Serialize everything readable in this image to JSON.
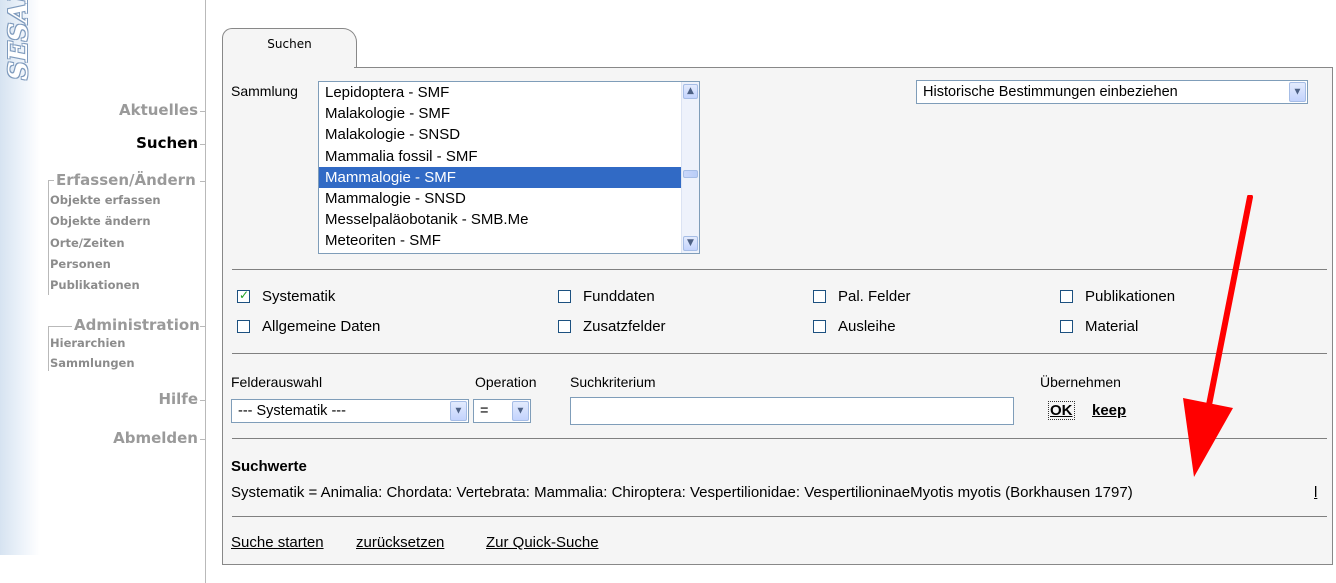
{
  "logo": {
    "text": "SESAM"
  },
  "nav": {
    "aktuelles": "Aktuelles",
    "suchen": "Suchen",
    "erfassen": {
      "label": "Erfassen/Ändern",
      "items": [
        "Objekte erfassen",
        "Objekte ändern",
        "Orte/Zeiten",
        "Personen",
        "Publikationen"
      ]
    },
    "administration": {
      "label": "Administration",
      "items": [
        "Hierarchien",
        "Sammlungen"
      ]
    },
    "hilfe": "Hilfe",
    "abmelden": "Abmelden"
  },
  "tab": {
    "label": "Suchen"
  },
  "sammlung": {
    "label": "Sammlung",
    "items": [
      "Lepidoptera - SMF",
      "Malakologie - SMF",
      "Malakologie - SNSD",
      "Mammalia fossil - SMF",
      "Mammalogie - SMF",
      "Mammalogie - SNSD",
      "Messelpaläobotanik - SMB.Me",
      "Meteoriten - SMF"
    ],
    "selected_index": 4
  },
  "historisch": {
    "value": "Historische Bestimmungen einbeziehen"
  },
  "checkboxes": [
    {
      "label": "Systematik",
      "checked": true
    },
    {
      "label": "Funddaten",
      "checked": false
    },
    {
      "label": "Pal. Felder",
      "checked": false
    },
    {
      "label": "Publikationen",
      "checked": false
    },
    {
      "label": "Allgemeine Daten",
      "checked": false
    },
    {
      "label": "Zusatzfelder",
      "checked": false
    },
    {
      "label": "Ausleihe",
      "checked": false
    },
    {
      "label": "Material",
      "checked": false
    }
  ],
  "criteria": {
    "felderauswahl_label": "Felderauswahl",
    "operation_label": "Operation",
    "suchkriterium_label": "Suchkriterium",
    "uebernehmen_label": "Übernehmen",
    "felderauswahl_value": "--- Systematik ---",
    "operation_value": "=",
    "suchkriterium_value": "",
    "ok": "OK",
    "keep": "keep"
  },
  "suchwerte": {
    "title": "Suchwerte",
    "line": "Systematik =  Animalia: Chordata: Vertebrata: Mammalia: Chiroptera: Vespertilionidae: VespertilioninaeMyotis myotis (Borkhausen 1797)",
    "remove": "l"
  },
  "footer": {
    "start": "Suche starten",
    "reset": "zurücksetzen",
    "quick": "Zur Quick-Suche"
  },
  "colors": {
    "selection": "#316ac5",
    "annotation_arrow": "#ff0000"
  }
}
